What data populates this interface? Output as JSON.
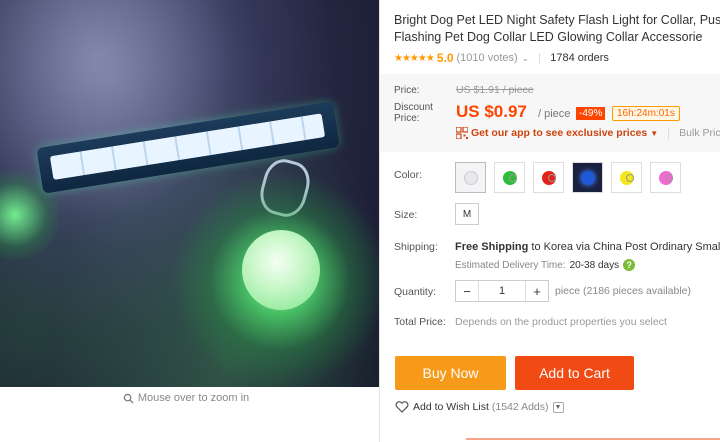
{
  "product": {
    "title": "Bright Dog Pet LED Night Safety Flash Light for Collar, Pus Flashing Pet Dog Collar LED Glowing Collar Accessorie",
    "stars": "★★★★★",
    "rating": "5.0",
    "votes": "(1010 votes)",
    "orders": "1784 orders"
  },
  "image": {
    "zoom_hint": "Mouse over to zoom in"
  },
  "price": {
    "price_label": "Price:",
    "original": "US $1.91 / piece",
    "discount_label": "Discount Price:",
    "current": "US $0.97",
    "per": "/ piece",
    "discount_badge": "-49%",
    "countdown": "16h:24m:01s",
    "app_link": "Get our app to see exclusive prices",
    "bulk": "Bulk Price"
  },
  "options": {
    "color_label": "Color:",
    "colors": [
      "white",
      "green",
      "red",
      "blue",
      "yellow",
      "pink"
    ],
    "color_hex": [
      "#e8e8ee",
      "#2ebd3a",
      "#e2231a",
      "#1e58d6",
      "#f4e81a",
      "#f06ad2"
    ],
    "size_label": "Size:",
    "size": "M"
  },
  "shipping": {
    "label": "Shipping:",
    "free": "Free Shipping",
    "dest_text": " to Korea via China Post Ordinary Small",
    "estimate_label": "Estimated Delivery Time:",
    "days": "20-38 days"
  },
  "quantity": {
    "label": "Quantity:",
    "value": "1",
    "minus": "−",
    "plus": "+",
    "note": "piece (2186 pieces available)"
  },
  "total": {
    "label": "Total Price:",
    "note": "Depends on the product properties you select"
  },
  "actions": {
    "buy_now": "Buy Now",
    "add_to_cart": "Add to Cart",
    "wishlist": "Add to Wish List",
    "wishlist_count": "(1542 Adds)"
  }
}
